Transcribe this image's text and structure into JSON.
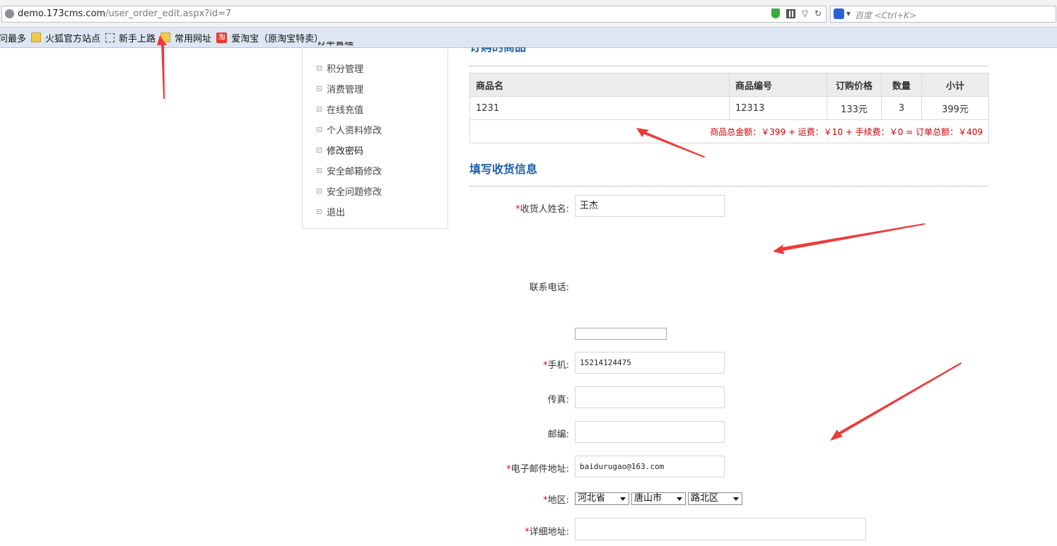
{
  "browser": {
    "url_host": "demo.173cms.com",
    "url_path": "/user_order_edit.aspx?id=7",
    "search_placeholder": "百度 <Ctrl+K>"
  },
  "bookmarks": [
    {
      "label": "问最多",
      "icon": "none"
    },
    {
      "label": "火狐官方站点",
      "icon": "folder-icon"
    },
    {
      "label": "新手上路",
      "icon": "dashed-box-icon"
    },
    {
      "label": "常用网址",
      "icon": "folder-icon"
    },
    {
      "label": "爱淘宝（原淘宝特卖）",
      "icon": "taobao-icon"
    }
  ],
  "sidebar": {
    "partial_item": "订单管理",
    "items": [
      {
        "label": "积分管理"
      },
      {
        "label": "消费管理"
      },
      {
        "label": "在线充值"
      },
      {
        "label": "个人资料修改"
      },
      {
        "label": "修改密码"
      },
      {
        "label": "安全邮箱修改"
      },
      {
        "label": "安全问题修改"
      },
      {
        "label": "退出"
      }
    ]
  },
  "order_section": {
    "partial_title": "订购的商品",
    "columns": [
      "商品名",
      "商品编号",
      "订购价格",
      "数量",
      "小计"
    ],
    "rows": [
      {
        "name": "1231",
        "code": "12313",
        "price": "133元",
        "qty": "3",
        "subtotal": "399元"
      }
    ],
    "total_line": "商品总金额：￥399 + 运费：￥10 + 手续费：￥0 = 订单总额：￥409"
  },
  "shipping": {
    "title": "填写收货信息",
    "required_mark": "*",
    "fields": {
      "name_label": "收货人姓名:",
      "name_value": "王杰",
      "phone_label": "联系电话:",
      "mobile_label": "手机:",
      "mobile_value": "15214124475",
      "fax_label": "传真:",
      "zip_label": "邮编:",
      "email_label": "电子邮件地址:",
      "email_value": "baidurugao@163.com",
      "region_label": "地区:",
      "province": "河北省",
      "city": "唐山市",
      "district": "路北区",
      "address_label": "详细地址:"
    }
  },
  "colors": {
    "title_blue": "#1f5fa9",
    "total_red": "#cc0000",
    "annotation_red": "#f03a3a"
  }
}
